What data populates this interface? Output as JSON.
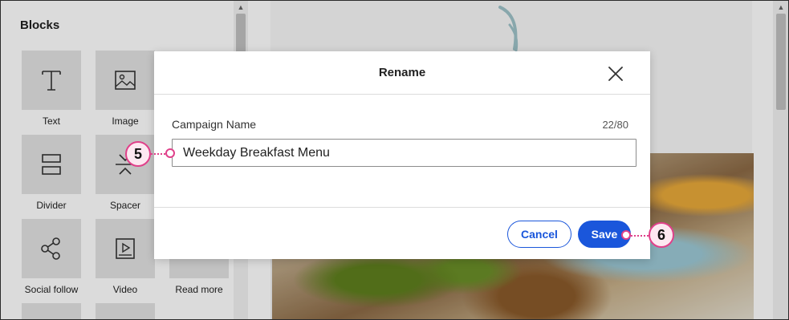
{
  "sidebar": {
    "title": "Blocks",
    "tiles": [
      {
        "label": "Text",
        "icon": "text-icon"
      },
      {
        "label": "Image",
        "icon": "image-icon"
      },
      {
        "label": "Divider",
        "icon": "divider-icon"
      },
      {
        "label": "Spacer",
        "icon": "spacer-icon"
      },
      {
        "label": "Social follow",
        "icon": "share-icon"
      },
      {
        "label": "Video",
        "icon": "video-icon"
      },
      {
        "label": "Read more",
        "icon": "read-more-icon"
      }
    ]
  },
  "dialog": {
    "title": "Rename",
    "field_label": "Campaign Name",
    "char_count": "22/80",
    "input_value": "Weekday Breakfast Menu",
    "cancel_label": "Cancel",
    "save_label": "Save"
  },
  "callouts": {
    "input_step": "5",
    "save_step": "6"
  },
  "colors": {
    "accent": "#1a56db",
    "callout": "#e0408a"
  }
}
